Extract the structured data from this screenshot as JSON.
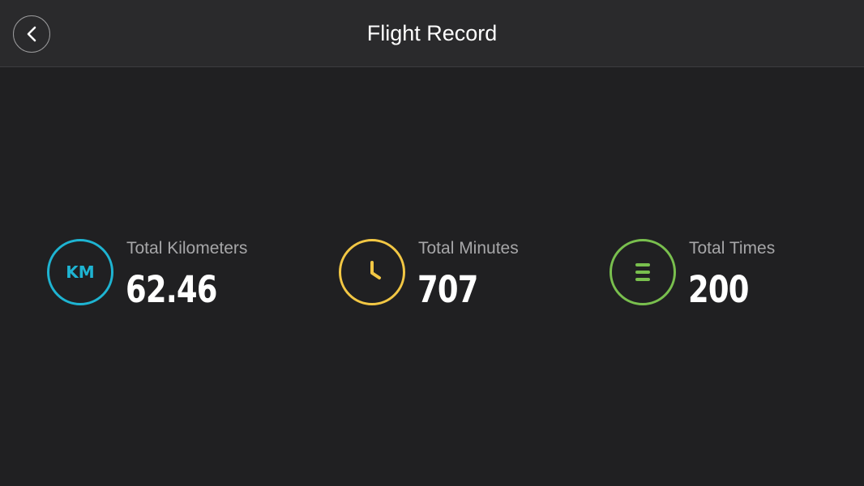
{
  "header": {
    "title": "Flight Record",
    "back_icon": "chevron-left-icon"
  },
  "colors": {
    "background": "#202022",
    "header_background": "#2a2a2c",
    "km_accent": "#1eb4d2",
    "minutes_accent": "#f2c744",
    "times_accent": "#79bf4e"
  },
  "stats": [
    {
      "label": "Total Kilometers",
      "value": "62.46",
      "icon_text": "KM",
      "icon": "km-icon"
    },
    {
      "label": "Total Minutes",
      "value": "707",
      "icon": "clock-icon"
    },
    {
      "label": "Total Times",
      "value": "200",
      "icon": "list-icon"
    }
  ]
}
